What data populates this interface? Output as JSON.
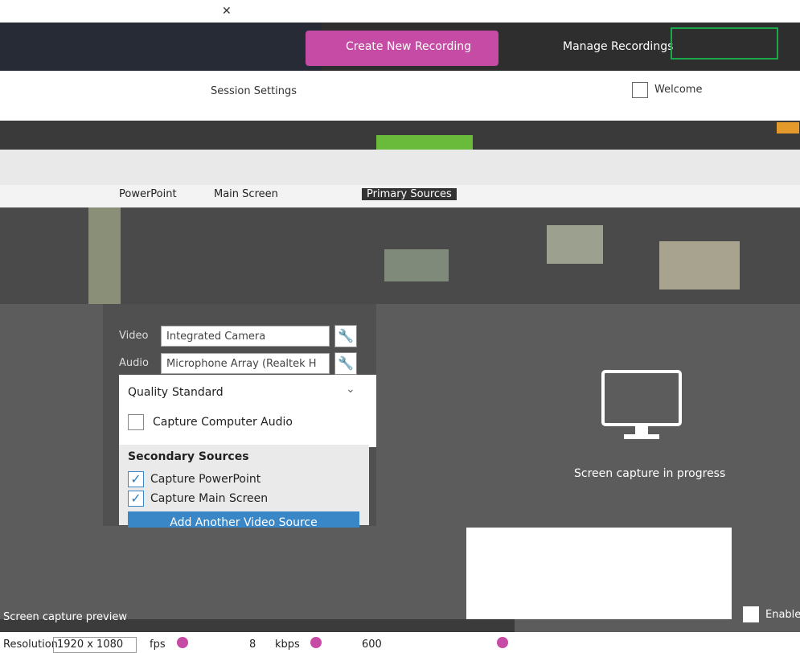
{
  "toolbar": {
    "create_label": "Create New Recording",
    "manage_label": "Manage Recordings"
  },
  "settings": {
    "session_label": "Session Settings",
    "welcome_label": "Welcome"
  },
  "tabs": {
    "powerpoint": "PowerPoint",
    "main_screen": "Main Screen",
    "primary_sources": "Primary Sources"
  },
  "sources": {
    "video_label": "Video",
    "video_value": "Integrated Camera",
    "audio_label": "Audio",
    "audio_value": "Microphone Array (Realtek H"
  },
  "quality": {
    "label": "Quality",
    "value": "Standard"
  },
  "capture_computer_audio": "Capture Computer Audio",
  "secondary": {
    "title": "Secondary Sources",
    "items": [
      "Capture PowerPoint",
      "Capture Main Screen"
    ],
    "add_button": "Add Another Video Source"
  },
  "preview": {
    "progress_text": "Screen capture in progress",
    "screen_capture_preview": "Screen capture preview",
    "enable": "Enable"
  },
  "bottom": {
    "resolution_label": "Resolution",
    "resolution_value": "1920 x 1080",
    "fps_label": "fps",
    "fps_value": "8",
    "kbps_label": "kbps",
    "kbps_value": "600"
  },
  "colors": {
    "accent_pink": "#c64ba4",
    "accent_blue": "#3a87c8",
    "accent_green": "#6aba3b"
  },
  "icons": {
    "close": "close-icon",
    "wrench": "wrench-icon",
    "monitor": "monitor-icon",
    "check": "check-icon",
    "chevron": "chevron-down-icon"
  }
}
